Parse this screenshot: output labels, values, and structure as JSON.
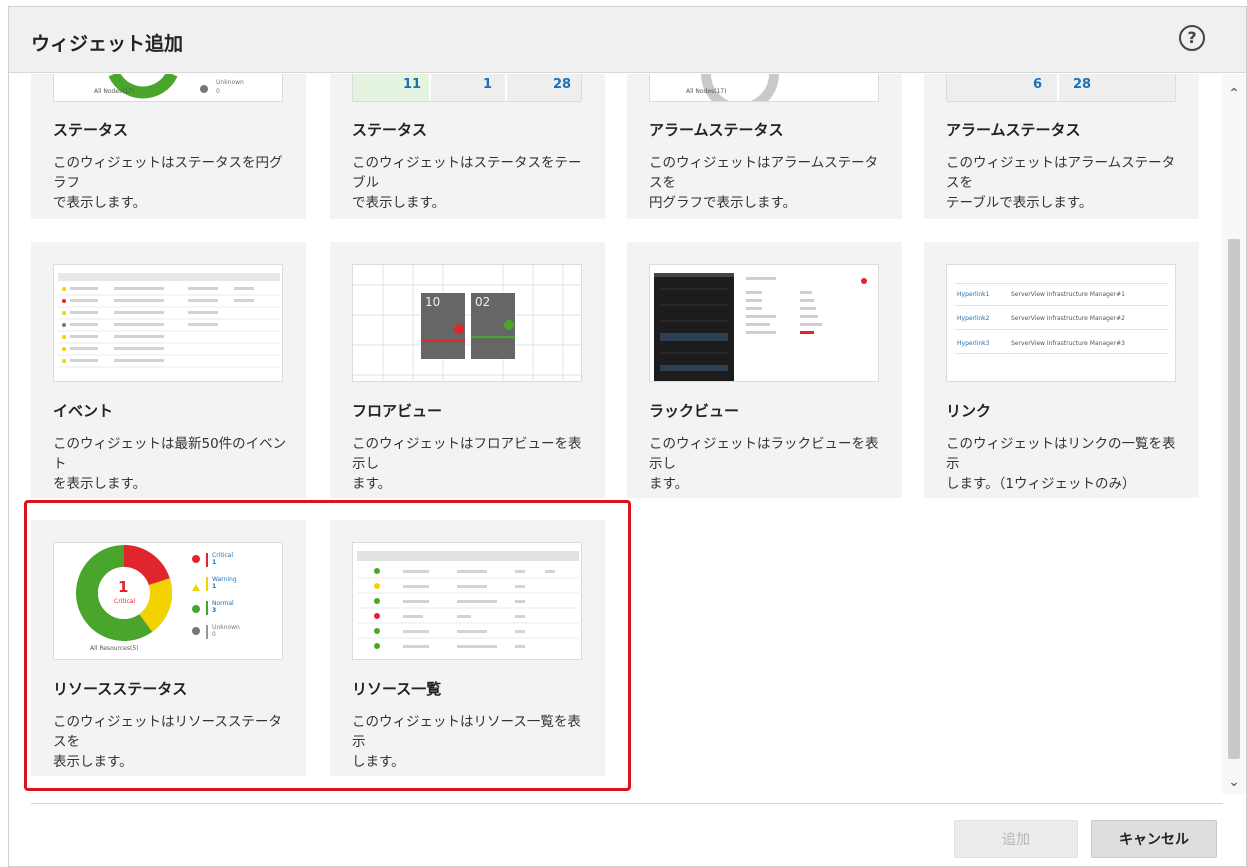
{
  "dialog": {
    "title": "ウィジェット追加",
    "help_icon": "?"
  },
  "widgets": [
    {
      "title": "ステータス",
      "desc": "このウィジェットはステータスを円グラフ\nで表示します。",
      "thumb": {
        "label": "All Nodes(17)",
        "legend": "Unknown",
        "count": "0"
      }
    },
    {
      "title": "ステータス",
      "desc": "このウィジェットはステータスをテーブル\nで表示します。",
      "thumb": {
        "values": [
          "11",
          "1",
          "28"
        ]
      }
    },
    {
      "title": "アラームステータス",
      "desc": "このウィジェットはアラームステータスを\n円グラフで表示します。",
      "thumb": {
        "label": "All Nodes(17)"
      }
    },
    {
      "title": "アラームステータス",
      "desc": "このウィジェットはアラームステータスを\nテーブルで表示します。",
      "thumb": {
        "values": [
          "6",
          "28"
        ]
      }
    },
    {
      "title": "イベント",
      "desc": "このウィジェットは最新50件のイベント\nを表示します。"
    },
    {
      "title": "フロアビュー",
      "desc": "このウィジェットはフロアビューを表示し\nます。",
      "thumb": {
        "values": [
          "10",
          "02"
        ]
      }
    },
    {
      "title": "ラックビュー",
      "desc": "このウィジェットはラックビューを表示し\nます。"
    },
    {
      "title": "リンク",
      "desc": "このウィジェットはリンクの一覧を表示\nします。（1ウィジェットのみ）",
      "thumb": {
        "links": [
          {
            "name": "Hyperlink1",
            "target": "ServerView Infrastructure Manager#1"
          },
          {
            "name": "Hyperlink2",
            "target": "ServerView Infrastructure Manager#2"
          },
          {
            "name": "Hyperlink3",
            "target": "ServerView Infrastructure Manager#3"
          }
        ]
      }
    },
    {
      "title": "リソースステータス",
      "desc": "このウィジェットはリソースステータスを\n表示します。",
      "thumb": {
        "center_value": "1",
        "center_label": "Critical",
        "footer": "All Resources(5)",
        "legend": [
          {
            "label": "Critical",
            "count": "1"
          },
          {
            "label": "Warning",
            "count": "1"
          },
          {
            "label": "Normal",
            "count": "3"
          },
          {
            "label": "Unknown",
            "count": "0"
          }
        ]
      }
    },
    {
      "title": "リソース一覧",
      "desc": "このウィジェットはリソース一覧を表示\nします。"
    }
  ],
  "footer": {
    "add_label": "追加",
    "cancel_label": "キャンセル"
  },
  "colors": {
    "critical": "#e0262c",
    "warning": "#f2d300",
    "normal": "#4aa52c",
    "unknown": "#777777",
    "highlight": "#d9121b"
  }
}
